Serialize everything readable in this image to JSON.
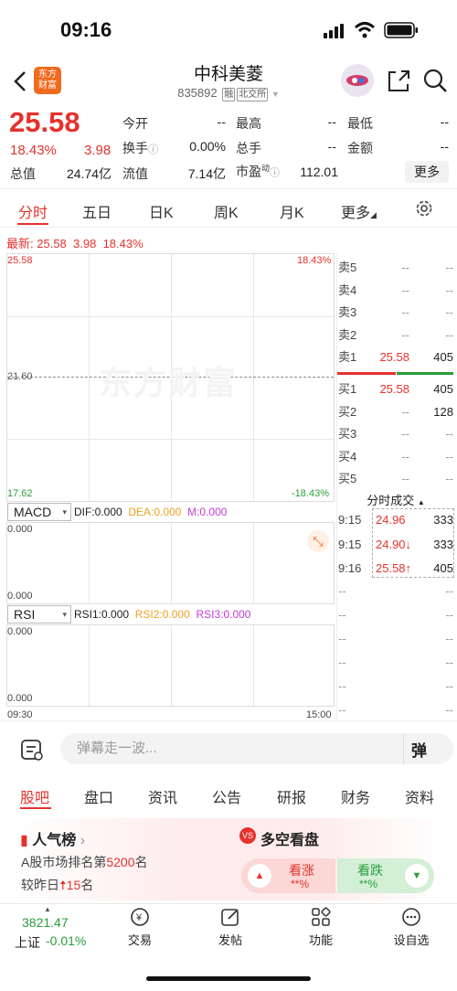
{
  "status": {
    "time": "09:16"
  },
  "header": {
    "logo_text": "东方\n财富",
    "title": "中科美菱",
    "code": "835892",
    "tag1": "融",
    "tag2": "北交所"
  },
  "quote": {
    "price": "25.58",
    "change_pct": "18.43%",
    "change": "3.98",
    "open_label": "今开",
    "open": "--",
    "high_label": "最高",
    "high": "--",
    "low_label": "最低",
    "low": "--",
    "turnover_label": "换手",
    "turnover": "0.00%",
    "volume_label": "总手",
    "volume": "--",
    "amount_label": "金额",
    "amount": "--",
    "mcap_label": "总值",
    "mcap": "24.74亿",
    "float_label": "流值",
    "float": "7.14亿",
    "pe_label": "市盈",
    "pe_sup": "动",
    "pe": "112.01",
    "more": "更多"
  },
  "tabs": [
    "分时",
    "五日",
    "日K",
    "周K",
    "月K",
    "更多"
  ],
  "latest": {
    "label": "最新:",
    "price": "25.58",
    "change": "3.98",
    "pct": "18.43%"
  },
  "chart": {
    "top_left": "25.58",
    "top_right": "18.43%",
    "mid": "21.60",
    "bottom_left": "17.62",
    "bottom_right": "-18.43%",
    "watermark": "东方财富",
    "time_start": "09:30",
    "time_end": "15:00"
  },
  "macd": {
    "name": "MACD",
    "dif": "DIF:0.000",
    "dea": "DEA:0.000",
    "m": "M:0.000",
    "top": "0.000",
    "bottom": "0.000"
  },
  "rsi": {
    "name": "RSI",
    "rsi1": "RSI1:0.000",
    "rsi2": "RSI2:0.000",
    "rsi3": "RSI3:0.000",
    "top": "0.000",
    "bottom": "0.000"
  },
  "orderbook": {
    "sell": [
      {
        "label": "卖5",
        "price": "--",
        "vol": "--"
      },
      {
        "label": "卖4",
        "price": "--",
        "vol": "--"
      },
      {
        "label": "卖3",
        "price": "--",
        "vol": "--"
      },
      {
        "label": "卖2",
        "price": "--",
        "vol": "--"
      },
      {
        "label": "卖1",
        "price": "25.58",
        "vol": "405"
      }
    ],
    "buy": [
      {
        "label": "买1",
        "price": "25.58",
        "vol": "405"
      },
      {
        "label": "买2",
        "price": "--",
        "vol": "128"
      },
      {
        "label": "买3",
        "price": "--",
        "vol": "--"
      },
      {
        "label": "买4",
        "price": "--",
        "vol": "--"
      },
      {
        "label": "买5",
        "price": "--",
        "vol": "--"
      }
    ]
  },
  "trades": {
    "title": "分时成交",
    "rows": [
      {
        "time": "9:15",
        "price": "24.96",
        "vol": "333",
        "arrow": ""
      },
      {
        "time": "9:15",
        "price": "24.90↓",
        "vol": "333",
        "arrow": "down"
      },
      {
        "time": "9:16",
        "price": "25.58↑",
        "vol": "405",
        "arrow": "up"
      }
    ],
    "empty": "--"
  },
  "comment": {
    "placeholder": "弹幕走一波...",
    "danmu": "弹"
  },
  "bottom_tabs": [
    "股吧",
    "盘口",
    "资讯",
    "公告",
    "研报",
    "财务",
    "资料"
  ],
  "popularity": {
    "title": "人气榜",
    "line1_pre": "A股市场排名第",
    "line1_num": "5200",
    "line1_post": "名",
    "line2_pre": "较昨日",
    "line2_num": "15",
    "line2_post": "名"
  },
  "vote": {
    "title": "多空看盘",
    "up_label": "看涨",
    "up_val": "**%",
    "down_label": "看跌",
    "down_val": "**%"
  },
  "nav": {
    "index_val": "3821.47",
    "index_name": "上证",
    "index_pct": "-0.01%",
    "items": [
      "交易",
      "发帖",
      "功能",
      "设自选"
    ]
  },
  "colors": {
    "red": "#e5322d",
    "green": "#2a9d3b"
  }
}
